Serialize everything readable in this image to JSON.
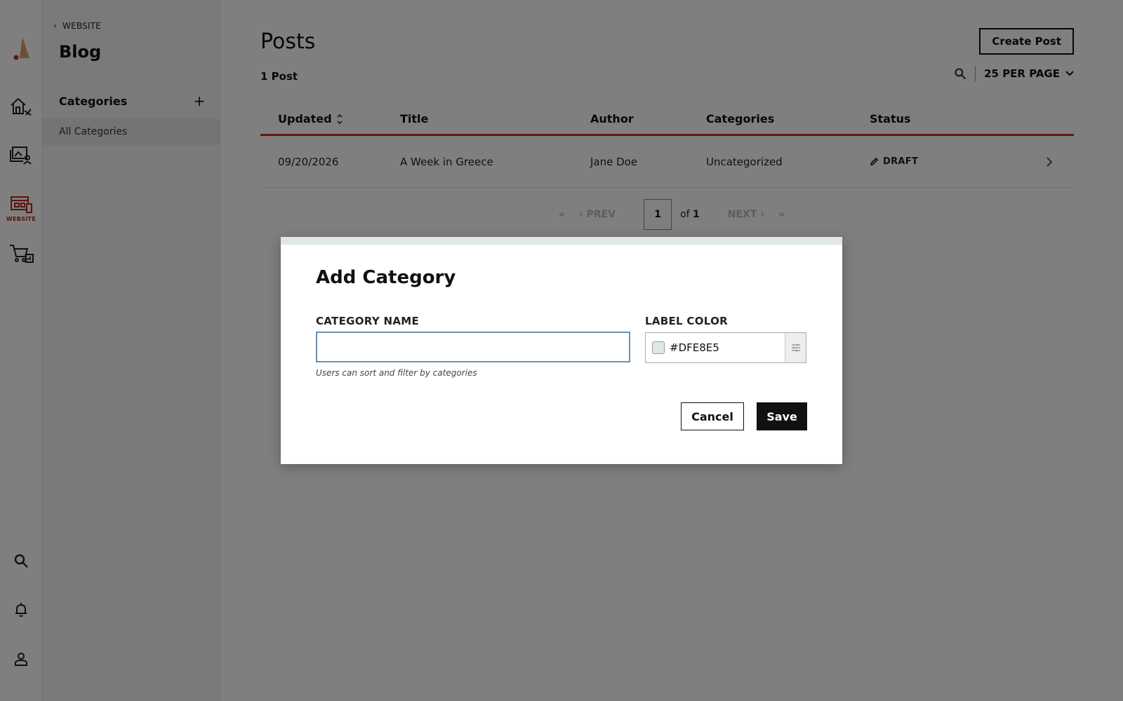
{
  "rail": {
    "items": [
      {
        "icon": "logo-icon"
      },
      {
        "icon": "home-tools-icon"
      },
      {
        "icon": "media-user-icon"
      },
      {
        "icon": "website-icon",
        "caption": "WEBSITE"
      },
      {
        "icon": "cart-chart-icon"
      },
      {
        "icon": "search-icon"
      },
      {
        "icon": "bell-icon"
      },
      {
        "icon": "user-icon"
      }
    ],
    "accent": "#b3261e"
  },
  "sidebar": {
    "back_label": "WEBSITE",
    "title": "Blog",
    "section_label": "Categories",
    "items": [
      {
        "label": "All Categories"
      }
    ]
  },
  "main": {
    "title": "Posts",
    "create_label": "Create Post",
    "count_label": "1 Post",
    "per_page_label": "25 PER PAGE",
    "columns": [
      "Updated",
      "Title",
      "Author",
      "Categories",
      "Status"
    ],
    "rows": [
      {
        "updated": "09/20/2026",
        "title": "A Week in Greece",
        "author": "Jane Doe",
        "categories": "Uncategorized",
        "status": "DRAFT"
      }
    ],
    "pagination": {
      "prev_label": "PREV",
      "next_label": "NEXT",
      "current_page": "1",
      "of_label": "of",
      "total_pages": "1"
    },
    "header_accent": "#c62828"
  },
  "modal": {
    "title": "Add Category",
    "name_label": "CATEGORY NAME",
    "name_value": "",
    "help_text": "Users can sort and filter by categories",
    "color_label": "LABEL COLOR",
    "color_value": "#DFE8E5",
    "cancel_label": "Cancel",
    "save_label": "Save"
  }
}
